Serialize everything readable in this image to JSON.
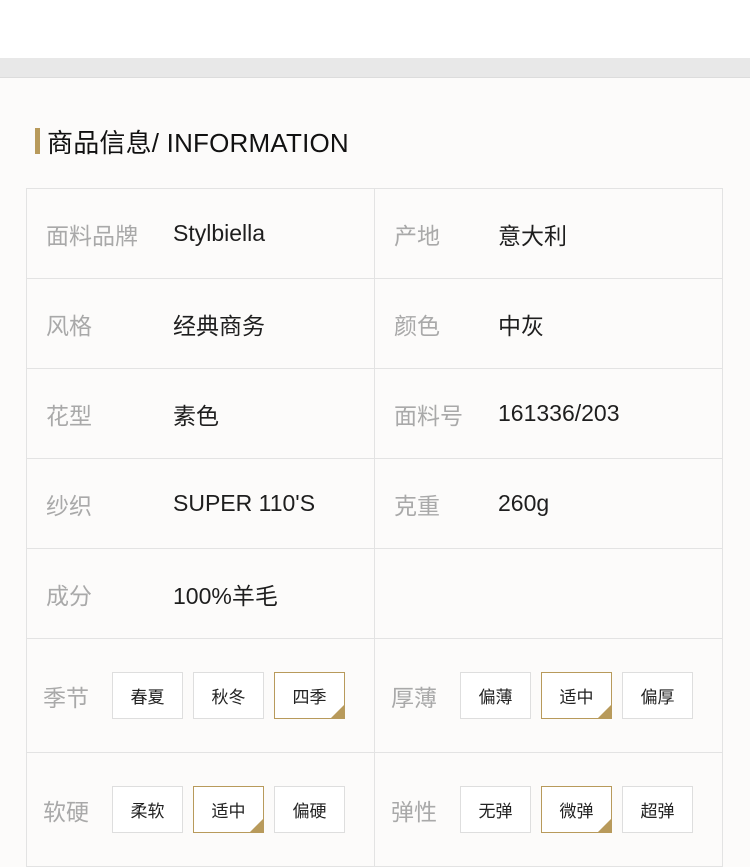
{
  "section": {
    "title": "商品信息/ INFORMATION"
  },
  "attributes": [
    {
      "label": "面料品牌",
      "value": "Stylbiella"
    },
    {
      "label": "产地",
      "value": "意大利"
    },
    {
      "label": "风格",
      "value": "经典商务"
    },
    {
      "label": "颜色",
      "value": "中灰"
    },
    {
      "label": "花型",
      "value": "素色"
    },
    {
      "label": "面料号",
      "value": "161336/203"
    },
    {
      "label": "纱织",
      "value": "SUPER 110'S"
    },
    {
      "label": "克重",
      "value": "260g"
    },
    {
      "label": "成分",
      "value": "100%羊毛"
    }
  ],
  "options": {
    "season": {
      "label": "季节",
      "choices": [
        "春夏",
        "秋冬",
        "四季"
      ],
      "selected": "四季"
    },
    "thickness": {
      "label": "厚薄",
      "choices": [
        "偏薄",
        "适中",
        "偏厚"
      ],
      "selected": "适中"
    },
    "hardness": {
      "label": "软硬",
      "choices": [
        "柔软",
        "适中",
        "偏硬"
      ],
      "selected": "适中"
    },
    "elasticity": {
      "label": "弹性",
      "choices": [
        "无弹",
        "微弹",
        "超弹"
      ],
      "selected": "微弹"
    }
  },
  "colors": {
    "accent": "#b89a5b",
    "label_gray": "#a9a9a9",
    "border": "#e3e3e3",
    "separator": "#e8e8e8"
  }
}
